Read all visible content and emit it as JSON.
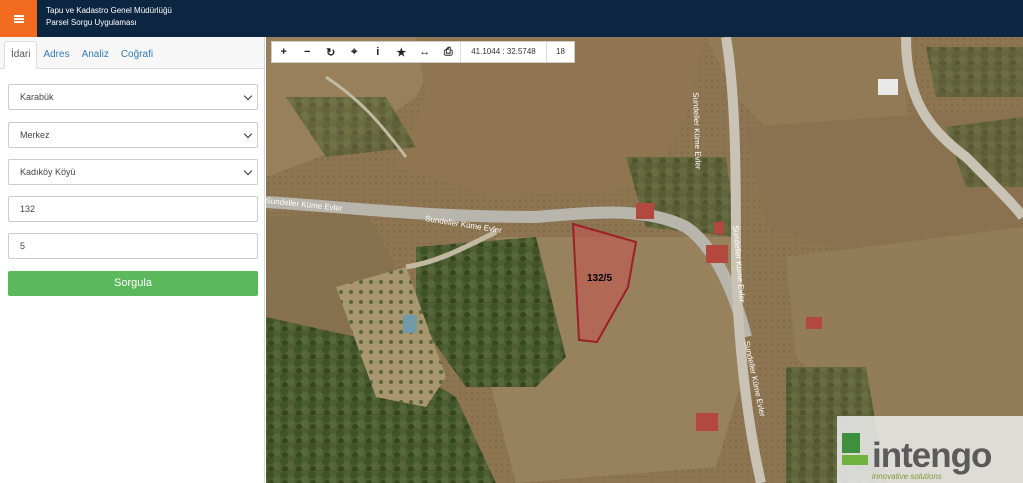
{
  "header": {
    "title_line1": "Tapu ve Kadastro Genel Müdürlüğü",
    "title_line2": "Parsel Sorgu Uygulaması",
    "menu_icon": "hamburger-icon",
    "brand_color": "#f26b21",
    "bar_color": "#0c2540"
  },
  "sidebar": {
    "tabs": [
      {
        "label": "İdari",
        "active": true
      },
      {
        "label": "Adres",
        "active": false
      },
      {
        "label": "Analiz",
        "active": false
      },
      {
        "label": "Coğrafi",
        "active": false
      }
    ],
    "province": "Karabük",
    "district": "Merkez",
    "neighborhood": "Kadıköy Köyü",
    "block": "132",
    "parcel": "5",
    "submit_label": "Sorgula",
    "submit_color": "#5cb85c"
  },
  "map": {
    "toolbar": {
      "icons": [
        "zoom-in-icon",
        "zoom-out-icon",
        "refresh-icon",
        "locate-icon",
        "info-icon",
        "star-icon",
        "measure-icon",
        "print-icon"
      ],
      "coordinates": "41.1044 : 32.5748",
      "zoom": "18"
    },
    "parcel_label": "132/5",
    "road_label_1": "Sundeller Küme Evler",
    "road_label_2": "Sundeller Küme Evler",
    "road_label_3": "Sundeller Küme Evler",
    "road_label_4": "Sundeller Küme Evler",
    "road_label_5": "Sundeller Küme Evler",
    "watermark_main": "intengo",
    "watermark_sub": "innovative solutions"
  }
}
